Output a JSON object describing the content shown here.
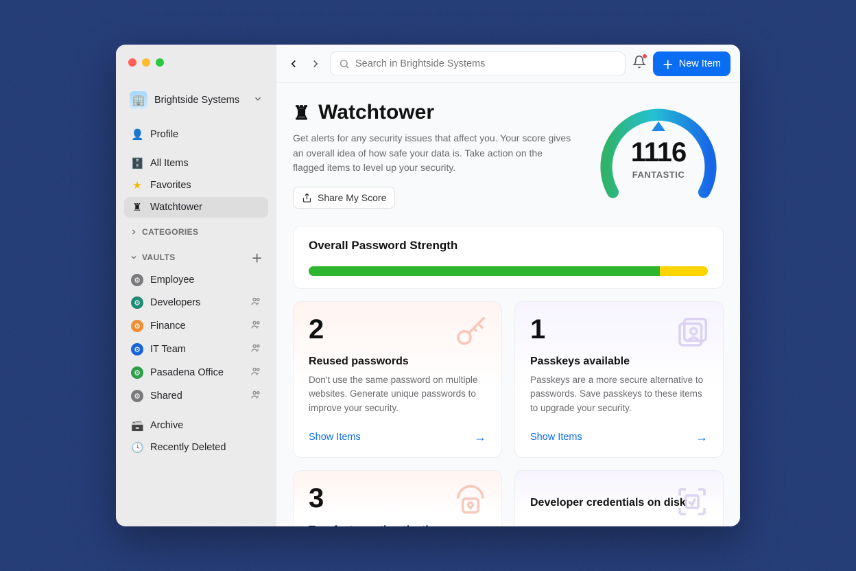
{
  "workspace": {
    "name": "Brightside Systems",
    "icon": "🏢"
  },
  "sidebar": {
    "profile_label": "Profile",
    "items": [
      {
        "label": "All Items",
        "icon": "🗄️"
      },
      {
        "label": "Favorites",
        "icon": "⭐"
      },
      {
        "label": "Watchtower",
        "icon": "🗼"
      }
    ],
    "categories_label": "CATEGORIES",
    "vaults_label": "VAULTS",
    "vaults": [
      {
        "label": "Employee",
        "shared": false,
        "icon_class": "vi-gray"
      },
      {
        "label": "Developers",
        "shared": true,
        "icon_class": "vi-teal"
      },
      {
        "label": "Finance",
        "shared": true,
        "icon_class": "vi-orange"
      },
      {
        "label": "IT Team",
        "shared": true,
        "icon_class": "vi-blue"
      },
      {
        "label": "Pasadena Office",
        "shared": true,
        "icon_class": "vi-green"
      },
      {
        "label": "Shared",
        "shared": true,
        "icon_class": "vi-gray"
      }
    ],
    "archive_label": "Archive",
    "recently_deleted_label": "Recently Deleted"
  },
  "topbar": {
    "search_placeholder": "Search in Brightside Systems",
    "new_item_label": "New Item"
  },
  "watchtower": {
    "heading": "Watchtower",
    "description": "Get alerts for any security issues that affect you. Your score gives an overall idea of how safe your data is. Take action on the flagged items to level up your security.",
    "share_label": "Share My Score",
    "score": "1116",
    "rating": "FANTASTIC",
    "strength_title": "Overall Password Strength",
    "strength_green_pct": 88,
    "strength_yellow_pct": 12,
    "cards": [
      {
        "count": "2",
        "title": "Reused passwords",
        "desc": "Don't use the same password on multiple websites. Generate unique passwords to improve your security.",
        "link": "Show Items",
        "tint": "red"
      },
      {
        "count": "1",
        "title": "Passkeys available",
        "desc": "Passkeys are a more secure alternative to passwords. Save passkeys to these items to upgrade your security.",
        "link": "Show Items",
        "tint": "purple"
      },
      {
        "count": "3",
        "title": "Two-factor authentication",
        "desc": "",
        "link": "",
        "tint": "red"
      },
      {
        "count": "",
        "title": "Developer credentials on disk",
        "desc": "",
        "link": "",
        "tint": "purple"
      }
    ]
  }
}
